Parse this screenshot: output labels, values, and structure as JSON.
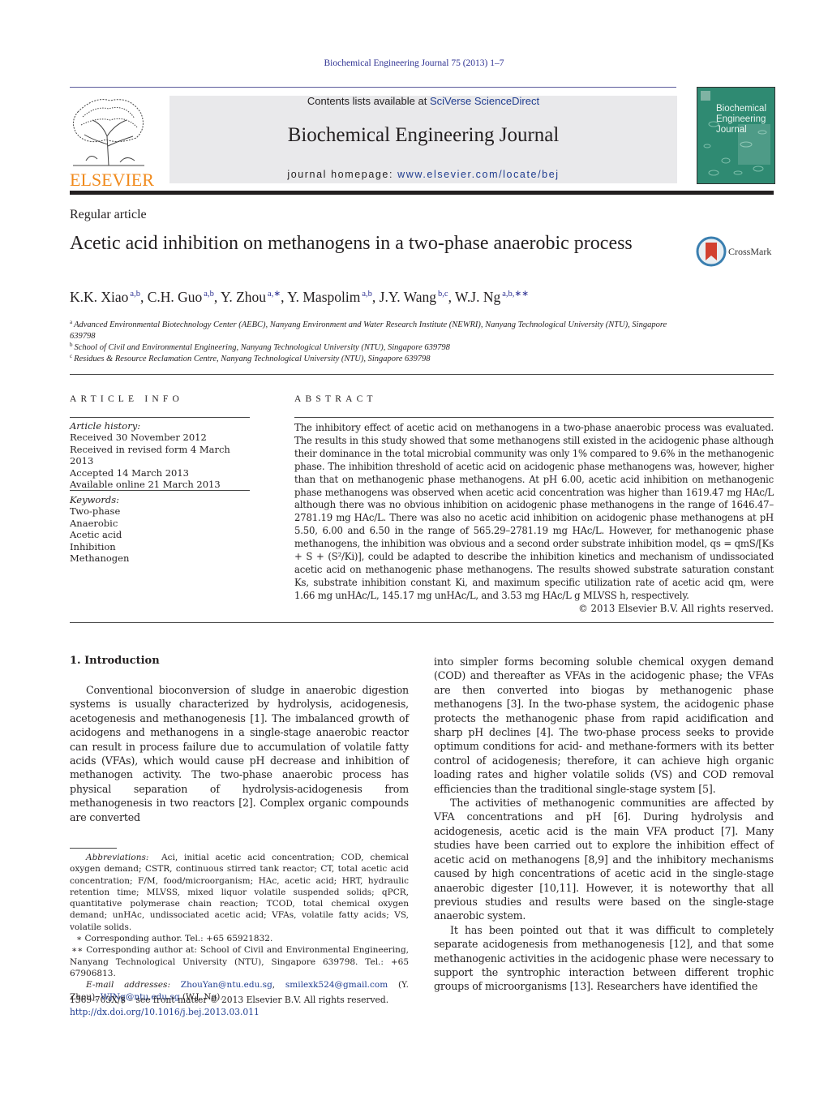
{
  "header": {
    "journal_ref": "Biochemical Engineering Journal 75 (2013) 1–7",
    "publisher_logo_text": "ELSEVIER",
    "contents_prefix": "Contents lists available at ",
    "contents_link": "SciVerse ScienceDirect",
    "journal_title": "Biochemical Engineering Journal",
    "homepage_prefix": "journal homepage: ",
    "homepage_link": "www.elsevier.com/locate/bej",
    "cover_lines": [
      "Biochemical",
      "Engineering",
      "Journal"
    ],
    "colors": {
      "publisher_orange": "#f08a1c",
      "link_blue": "#2e3192",
      "cover_green": "#2f8a72",
      "masthead_gray": "#e9e9eb"
    }
  },
  "article": {
    "type": "Regular article",
    "title": "Acetic acid inhibition on methanogens in a two-phase anaerobic process",
    "crossmark_label": "CrossMark",
    "authors": [
      {
        "name": "K.K. Xiao",
        "sup": "a,b"
      },
      {
        "name": "C.H. Guo",
        "sup": "a,b"
      },
      {
        "name": "Y. Zhou",
        "sup": "a,∗"
      },
      {
        "name": "Y. Maspolim",
        "sup": "a,b"
      },
      {
        "name": "J.Y. Wang",
        "sup": "b,c"
      },
      {
        "name": "W.J. Ng",
        "sup": "a,b,∗∗"
      }
    ],
    "affiliations": [
      {
        "key": "a",
        "text": "Advanced Environmental Biotechnology Center (AEBC), Nanyang Environment and Water Research Institute (NEWRI), Nanyang Technological University (NTU), Singapore 639798"
      },
      {
        "key": "b",
        "text": "School of Civil and Environmental Engineering, Nanyang Technological University (NTU), Singapore 639798"
      },
      {
        "key": "c",
        "text": "Residues & Resource Reclamation Centre, Nanyang Technological University (NTU), Singapore 639798"
      }
    ]
  },
  "article_info": {
    "heading": "ARTICLE INFO",
    "history_label": "Article history:",
    "history": [
      "Received 30 November 2012",
      "Received in revised form 4 March 2013",
      "Accepted 14 March 2013",
      "Available online 21 March 2013"
    ],
    "keywords_label": "Keywords:",
    "keywords": [
      "Two-phase",
      "Anaerobic",
      "Acetic acid",
      "Inhibition",
      "Methanogen"
    ]
  },
  "abstract": {
    "heading": "ABSTRACT",
    "text": "The inhibitory effect of acetic acid on methanogens in a two-phase anaerobic process was evaluated. The results in this study showed that some methanogens still existed in the acidogenic phase although their dominance in the total microbial community was only 1% compared to 9.6% in the methanogenic phase. The inhibition threshold of acetic acid on acidogenic phase methanogens was, however, higher than that on methanogenic phase methanogens. At pH 6.00, acetic acid inhibition on methanogenic phase methanogens was observed when acetic acid concentration was higher than 1619.47 mg HAc/L although there was no obvious inhibition on acidogenic phase methanogens in the range of 1646.47–2781.19 mg HAc/L. There was also no acetic acid inhibition on acidogenic phase methanogens at pH 5.50, 6.00 and 6.50 in the range of 565.29–2781.19 mg HAc/L. However, for methanogenic phase methanogens, the inhibition was obvious and a second order substrate inhibition model, qs = qmS/[Ks + S + (S²/Ki)], could be adapted to describe the inhibition kinetics and mechanism of undissociated acetic acid on methanogenic phase methanogens. The results showed substrate saturation constant Ks, substrate inhibition constant Ki, and maximum specific utilization rate of acetic acid qm, were 1.66 mg unHAc/L, 145.17 mg unHAc/L, and 3.53 mg HAc/L g MLVSS h, respectively.",
    "copyright": "© 2013 Elsevier B.V. All rights reserved."
  },
  "intro": {
    "heading": "1.  Introduction",
    "left_paragraph": "Conventional bioconversion of sludge in anaerobic digestion systems is usually characterized by hydrolysis, acidogenesis, acetogenesis and methanogenesis [1]. The imbalanced growth of acidogens and methanogens in a single-stage anaerobic reactor can result in process failure due to accumulation of volatile fatty acids (VFAs), which would cause pH decrease and inhibition of methanogen activity. The two-phase anaerobic process has physical separation of hydrolysis-acidogenesis from methanogenesis in two reactors [2]. Complex organic compounds are converted",
    "right_paragraphs": [
      "into simpler forms becoming soluble chemical oxygen demand (COD) and thereafter as VFAs in the acidogenic phase; the VFAs are then converted into biogas by methanogenic phase methanogens [3]. In the two-phase system, the acidogenic phase protects the methanogenic phase from rapid acidification and sharp pH declines [4]. The two-phase process seeks to provide optimum conditions for acid- and methane-formers with its better control of acidogenesis; therefore, it can achieve high organic loading rates and higher volatile solids (VS) and COD removal efficiencies than the traditional single-stage system [5].",
      "The activities of methanogenic communities are affected by VFA concentrations and pH [6]. During hydrolysis and acidogenesis, acetic acid is the main VFA product [7]. Many studies have been carried out to explore the inhibition effect of acetic acid on methanogens [8,9] and the inhibitory mechanisms caused by high concentrations of acetic acid in the single-stage anaerobic digester [10,11]. However, it is noteworthy that all previous studies and results were based on the single-stage anaerobic system.",
      "It has been pointed out that it was difficult to completely separate acidogenesis from methanogenesis [12], and that some methanogenic activities in the acidogenic phase were necessary to support the syntrophic interaction between different trophic groups of microorganisms [13]. Researchers have identified the"
    ]
  },
  "footnotes": {
    "abbreviations_label": "Abbreviations:",
    "abbreviations": "Aci, initial acetic acid concentration; COD, chemical oxygen demand; CSTR, continuous stirred tank reactor; CT, total acetic acid concentration; F/M, food/microorganism; HAc, acetic acid; HRT, hydraulic retention time; MLVSS, mixed liquor volatile suspended solids; qPCR, quantitative polymerase chain reaction; TCOD, total chemical oxygen demand; unHAc, undissociated acetic acid; VFAs, volatile fatty acids; VS, volatile solids.",
    "corresponding1": "∗ Corresponding author. Tel.: +65 65921832.",
    "corresponding2": "∗∗ Corresponding author at: School of Civil and Environmental Engineering, Nanyang Technological University (NTU), Singapore 639798. Tel.: +65 67906813.",
    "email_label": "E-mail addresses:",
    "emails": [
      {
        "address": "ZhouYan@ntu.edu.sg",
        "suffix": ", "
      },
      {
        "address": "smilexk524@gmail.com",
        "suffix": " (Y. Zhou), "
      },
      {
        "address": "WJNg@ntu.edu.sg",
        "suffix": " (W.J. Ng)."
      }
    ],
    "front_matter": "1369-703X/$ – see front matter © 2013 Elsevier B.V. All rights reserved.",
    "doi": "http://dx.doi.org/10.1016/j.bej.2013.03.011"
  }
}
